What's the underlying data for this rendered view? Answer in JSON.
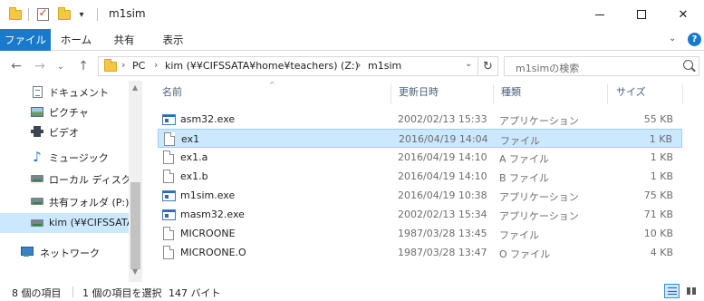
{
  "window": {
    "title": "m1sim",
    "close_glyph": "✕",
    "dropdown_glyph": "▾"
  },
  "ribbon": {
    "tabs": [
      "ファイル",
      "ホーム",
      "共有",
      "表示"
    ],
    "expand_glyph": "⌄",
    "help_glyph": "?"
  },
  "address": {
    "back_glyph": "←",
    "forward_glyph": "→",
    "history_glyph": "⌄",
    "up_glyph": "↑",
    "crumbs": [
      "PC",
      "kim (¥¥CIFSSATA¥home¥teachers) (Z:)",
      "m1sim"
    ],
    "sep_glyph": "›",
    "dropdown_glyph": "⌄",
    "refresh_glyph": "↻"
  },
  "search": {
    "placeholder": "m1simの検索"
  },
  "navpane": {
    "items": [
      {
        "label": "ドキュメント",
        "icon": "documents-icon"
      },
      {
        "label": "ピクチャ",
        "icon": "pictures-icon"
      },
      {
        "label": "ビデオ",
        "icon": "videos-icon"
      },
      {
        "label": "ミュージック",
        "icon": "music-icon"
      },
      {
        "label": "ローカル ディスク (C",
        "icon": "local-disk-icon"
      },
      {
        "label": "共有フォルダ (P:)",
        "icon": "network-drive-icon"
      },
      {
        "label": "kim (¥¥CIFSSATA",
        "icon": "network-drive-icon"
      },
      {
        "label": "ネットワーク",
        "icon": "network-icon"
      }
    ],
    "selected_index": 6,
    "scroll_up_glyph": "▲",
    "scroll_down_glyph": "▼"
  },
  "filelist": {
    "columns": {
      "name": "名前",
      "date": "更新日時",
      "type": "種類",
      "size": "サイズ"
    },
    "sort_glyph": "^",
    "rows": [
      {
        "name": "asm32.exe",
        "date": "2002/02/13 15:33",
        "type": "アプリケーション",
        "size": "55 KB",
        "icon": "exe"
      },
      {
        "name": "ex1",
        "date": "2016/04/19 14:04",
        "type": "ファイル",
        "size": "1 KB",
        "icon": "file"
      },
      {
        "name": "ex1.a",
        "date": "2016/04/19 14:10",
        "type": "A ファイル",
        "size": "1 KB",
        "icon": "file"
      },
      {
        "name": "ex1.b",
        "date": "2016/04/19 14:10",
        "type": "B ファイル",
        "size": "1 KB",
        "icon": "file"
      },
      {
        "name": "m1sim.exe",
        "date": "2016/04/19 10:38",
        "type": "アプリケーション",
        "size": "75 KB",
        "icon": "exe"
      },
      {
        "name": "masm32.exe",
        "date": "2002/02/13 15:34",
        "type": "アプリケーション",
        "size": "71 KB",
        "icon": "exe"
      },
      {
        "name": "MICROONE",
        "date": "1987/03/28 13:45",
        "type": "ファイル",
        "size": "10 KB",
        "icon": "file"
      },
      {
        "name": "MICROONE.O",
        "date": "1987/03/28 13:47",
        "type": "O ファイル",
        "size": "4 KB",
        "icon": "file"
      }
    ],
    "selected_index": 1
  },
  "status": {
    "item_count": "8 個の項目",
    "selection": "1 個の項目を選択",
    "selection_size": "147 バイト"
  },
  "colors": {
    "accent": "#1979ca",
    "selection": "#cce8ff"
  }
}
